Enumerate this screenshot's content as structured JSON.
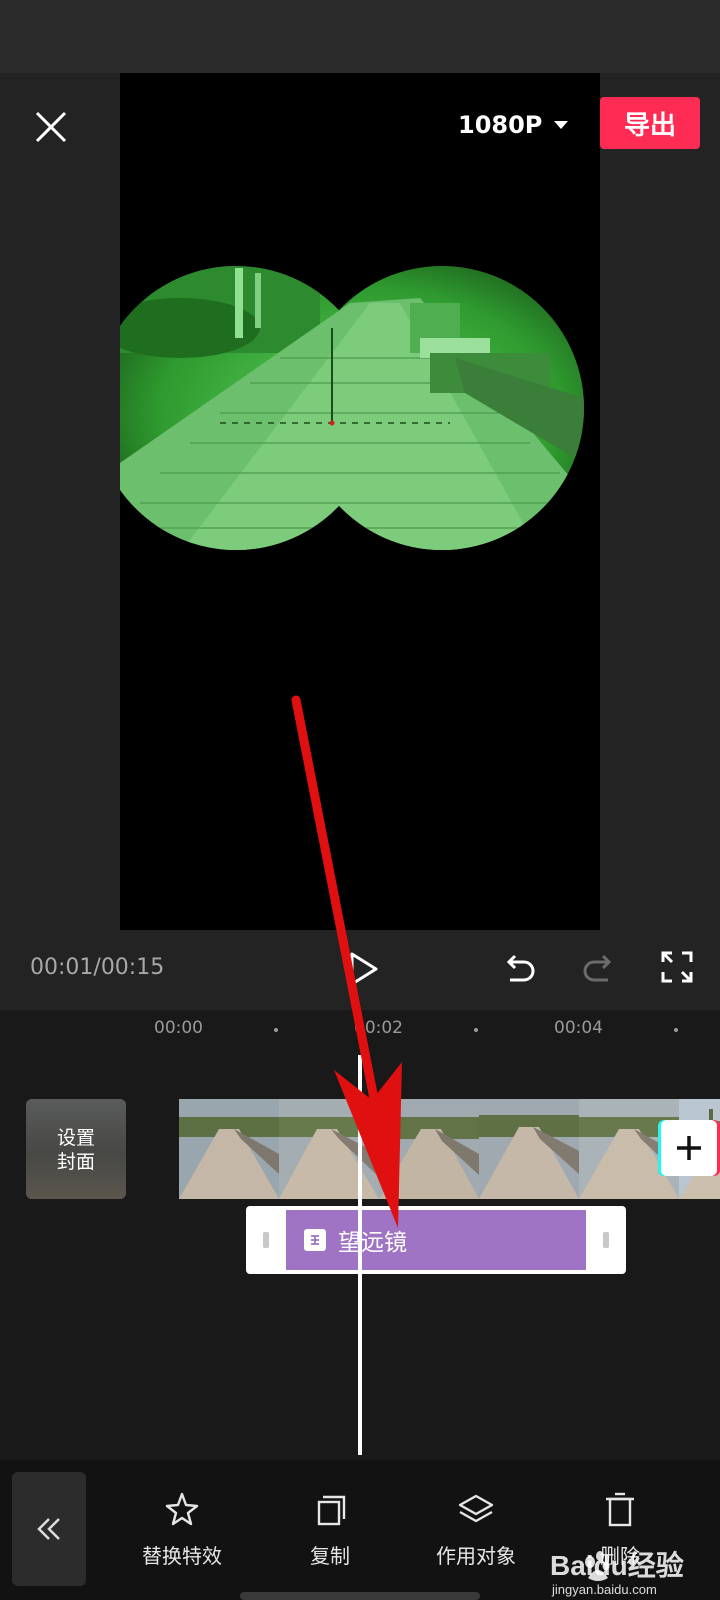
{
  "header": {
    "resolution": "1080P",
    "export_label": "导出"
  },
  "playback": {
    "time": "00:01/00:15"
  },
  "ruler": {
    "labels": [
      "00:00",
      "00:02",
      "00:04"
    ]
  },
  "cover": {
    "label_line1": "设置",
    "label_line2": "封面"
  },
  "effect": {
    "name": "望远镜",
    "badge": "主"
  },
  "toolbar": {
    "items": [
      {
        "label": "替换特效",
        "icon": "sparkle-star-icon"
      },
      {
        "label": "复制",
        "icon": "copy-icon"
      },
      {
        "label": "作用对象",
        "icon": "layers-icon"
      },
      {
        "label": "删除",
        "icon": "trash-icon"
      }
    ]
  },
  "watermark": {
    "brand": "Baidu经验",
    "url": "jingyan.baidu.com"
  },
  "colors": {
    "accent": "#fe2c55",
    "effect_clip": "#9f74c4",
    "night_vision": "#34a834",
    "arrow": "#e01010"
  }
}
